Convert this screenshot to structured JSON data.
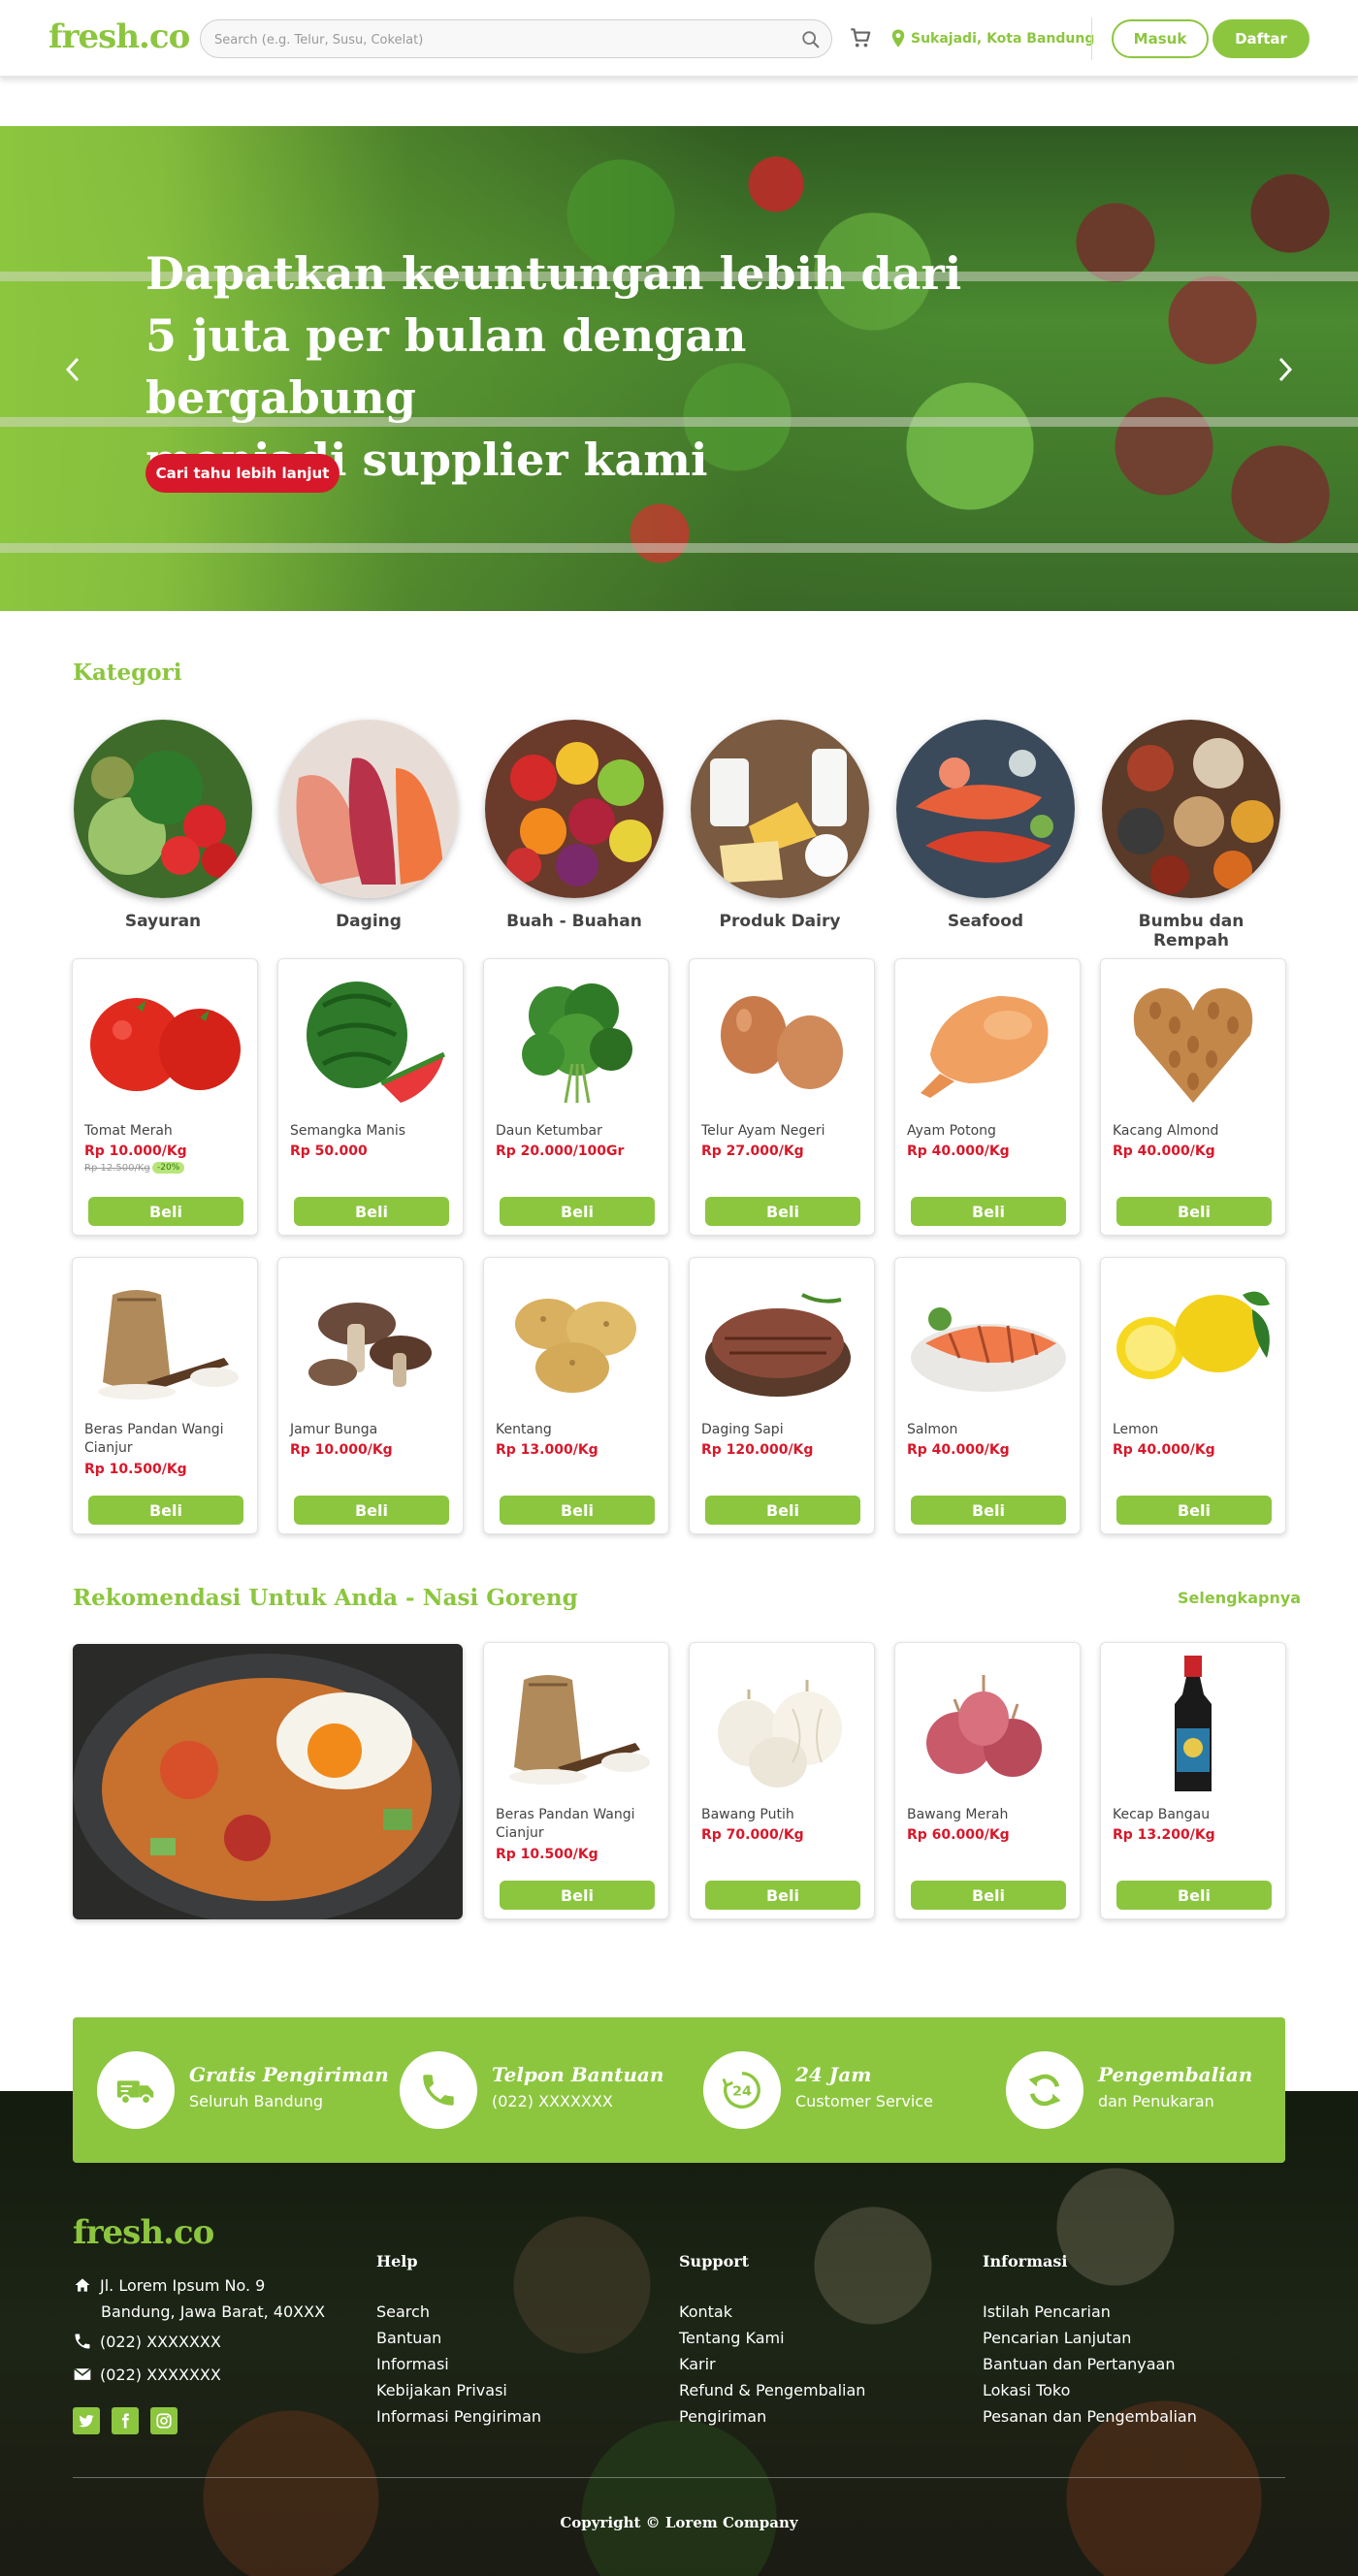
{
  "header": {
    "logo": "fresh.co",
    "search_placeholder": "Search (e.g. Telur, Susu, Cokelat)",
    "location": "Sukajadi, Kota Bandung",
    "login": "Masuk",
    "register": "Daftar"
  },
  "hero": {
    "title": "Dapatkan keuntungan lebih dari\n5  juta per bulan dengan bergabung\nmenjadi supplier kami",
    "cta": "Cari tahu lebih lanjut"
  },
  "categories": {
    "title": "Kategori",
    "items": [
      {
        "name": "Sayuran"
      },
      {
        "name": "Daging"
      },
      {
        "name": "Buah - Buahan"
      },
      {
        "name": "Produk Dairy"
      },
      {
        "name": "Seafood"
      },
      {
        "name": "Bumbu dan Rempah"
      }
    ]
  },
  "products": [
    {
      "name": "Tomat Merah",
      "price": "Rp 10.000/Kg",
      "old_price": "Rp 12.500/Kg",
      "discount": "-20%"
    },
    {
      "name": "Semangka Manis",
      "price": "Rp 50.000"
    },
    {
      "name": "Daun Ketumbar",
      "price": "Rp 20.000/100Gr"
    },
    {
      "name": "Telur Ayam Negeri",
      "price": "Rp 27.000/Kg"
    },
    {
      "name": "Ayam Potong",
      "price": "Rp 40.000/Kg"
    },
    {
      "name": "Kacang Almond",
      "price": "Rp 40.000/Kg"
    },
    {
      "name": "Beras Pandan Wangi Cianjur",
      "price": "Rp 10.500/Kg"
    },
    {
      "name": "Jamur Bunga",
      "price": "Rp 10.000/Kg"
    },
    {
      "name": "Kentang",
      "price": "Rp 13.000/Kg"
    },
    {
      "name": "Daging Sapi",
      "price": "Rp 120.000/Kg"
    },
    {
      "name": "Salmon",
      "price": "Rp 40.000/Kg"
    },
    {
      "name": "Lemon",
      "price": "Rp 40.000/Kg"
    }
  ],
  "buy_label": "Beli",
  "recommend": {
    "title": "Rekomendasi Untuk Anda - Nasi Goreng",
    "more": "Selengkapnya",
    "items": [
      {
        "name": "Beras Pandan Wangi Cianjur",
        "price": "Rp 10.500/Kg"
      },
      {
        "name": "Bawang Putih",
        "price": "Rp 70.000/Kg"
      },
      {
        "name": "Bawang Merah",
        "price": "Rp 60.000/Kg"
      },
      {
        "name": "Kecap Bangau",
        "price": "Rp 13.200/Kg"
      }
    ]
  },
  "features": [
    {
      "title": "Gratis Pengiriman",
      "subtitle": "Seluruh Bandung",
      "icon": "truck-icon"
    },
    {
      "title": "Telpon Bantuan",
      "subtitle": "(022) XXXXXXX",
      "icon": "phone-icon"
    },
    {
      "title": "24 Jam",
      "subtitle": "Customer Service",
      "icon": "clock-24-icon"
    },
    {
      "title": "Pengembalian",
      "subtitle": "dan Penukaran",
      "icon": "refresh-icon"
    }
  ],
  "footer": {
    "logo": "fresh.co",
    "address1": "Jl. Lorem Ipsum No. 9",
    "address2": "Bandung, Jawa Barat, 40XXX",
    "phone": "(022) XXXXXXX",
    "email": "(022) XXXXXXX",
    "columns": [
      {
        "title": "Help",
        "items": [
          "Search",
          "Bantuan",
          "Informasi",
          "Kebijakan Privasi",
          "Informasi Pengiriman"
        ]
      },
      {
        "title": "Support",
        "items": [
          "Kontak",
          "Tentang Kami",
          "Karir",
          "Refund & Pengembalian",
          "Pengiriman"
        ]
      },
      {
        "title": "Informasi",
        "items": [
          "Istilah Pencarian",
          "Pencarian Lanjutan",
          "Bantuan dan Pertanyaan",
          "Lokasi Toko",
          "Pesanan dan Pengembalian"
        ]
      }
    ],
    "copyright": "Copyright © Lorem Company"
  },
  "colors": {
    "accent": "#8cc63f",
    "price": "#d7182a",
    "cta": "#d7182a"
  }
}
